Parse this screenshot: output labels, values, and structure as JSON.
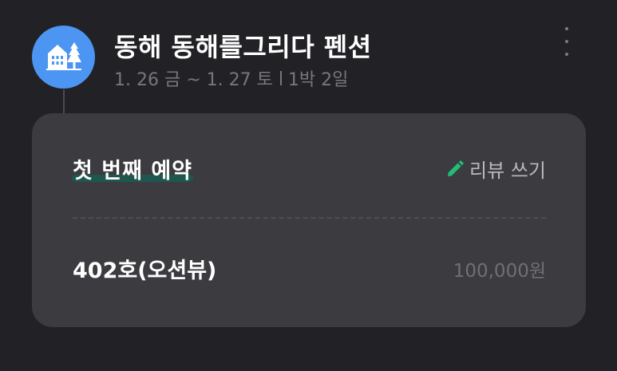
{
  "header": {
    "title": "동해 동해를그리다 펜션",
    "dates": "1. 26 금 ~ 1. 27 토",
    "nights": "1박 2일",
    "avatar_icon": "pension-house-icon",
    "more_icon": "more-vertical-icon"
  },
  "reservation": {
    "title": "첫 번째 예약",
    "review_label": "리뷰 쓰기",
    "review_icon": "pencil-icon",
    "room_name": "402호(오션뷰)",
    "price": "100,000원"
  },
  "colors": {
    "background": "#222226",
    "card": "#3b3b40",
    "avatar": "#4c95f2",
    "accent_green": "#1fbf7a",
    "underline": "#1e5750"
  }
}
